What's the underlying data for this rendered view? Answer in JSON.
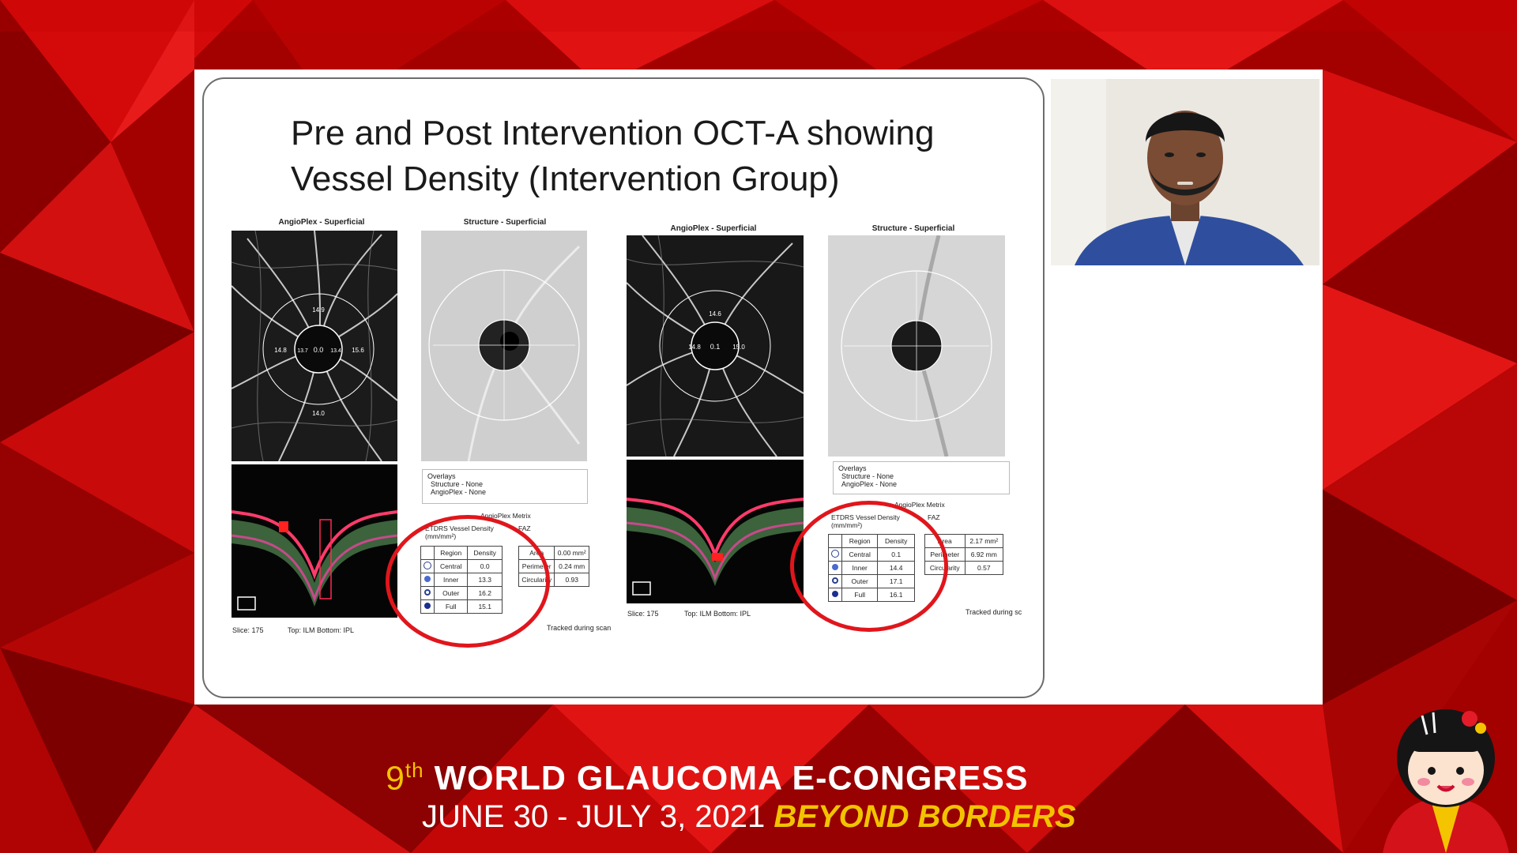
{
  "slide": {
    "title_line1": "Pre and Post Intervention OCT-A  showing",
    "title_line2": "Vessel Density  (Intervention Group)",
    "pre": {
      "angioplex_caption": "AngioPlex - Superficial",
      "structure_caption": "Structure - Superficial",
      "angio_values": {
        "top": "14.9",
        "left": "14.8",
        "center": "0.0",
        "right_inner": "13.4",
        "right": "15.6",
        "inner_left": "13.7",
        "bottom": "14.0"
      },
      "overlays_title": "Overlays",
      "overlay_structure": "Structure - None",
      "overlay_angioplex": "AngioPlex - None",
      "metrix_title": "AngioPlex Metrix",
      "etdrs_title": "ETDRS Vessel Density",
      "etdrs_unit": "(mm/mm²)",
      "faz_title": "FAZ",
      "table_headers": [
        "Region",
        "Density"
      ],
      "rows": [
        {
          "region": "Central",
          "density": "0.0"
        },
        {
          "region": "Inner",
          "density": "13.3"
        },
        {
          "region": "Outer",
          "density": "16.2"
        },
        {
          "region": "Full",
          "density": "15.1"
        }
      ],
      "faz_rows": [
        {
          "label": "Area",
          "value": "0.00 mm²"
        },
        {
          "label": "Perimeter",
          "value": "0.24 mm"
        },
        {
          "label": "Circularity",
          "value": "0.93"
        }
      ],
      "slice": "Slice: 175",
      "top_bottom": "Top: ILM  Bottom: IPL",
      "tracked": "Tracked during scan"
    },
    "post": {
      "angioplex_caption": "AngioPlex - Superficial",
      "structure_caption": "Structure - Superficial",
      "angio_values": {
        "top": "14.6",
        "left": "14.8",
        "center": "0.1",
        "right": "15.0"
      },
      "overlays_title": "Overlays",
      "overlay_structure": "Structure - None",
      "overlay_angioplex": "AngioPlex - None",
      "metrix_title": "AngioPlex Metrix",
      "etdrs_title": "ETDRS Vessel Density",
      "etdrs_unit": "(mm/mm²)",
      "faz_title": "FAZ",
      "table_headers": [
        "Region",
        "Density"
      ],
      "rows": [
        {
          "region": "Central",
          "density": "0.1"
        },
        {
          "region": "Inner",
          "density": "14.4"
        },
        {
          "region": "Outer",
          "density": "17.1"
        },
        {
          "region": "Full",
          "density": "16.1"
        }
      ],
      "faz_rows": [
        {
          "label": "Area",
          "value": "2.17 mm²"
        },
        {
          "label": "Perimeter",
          "value": "6.92 mm"
        },
        {
          "label": "Circularity",
          "value": "0.57"
        }
      ],
      "slice": "Slice: 175",
      "top_bottom": "Top: ILM  Bottom: IPL",
      "tracked": "Tracked during sc"
    }
  },
  "footer": {
    "ordinal": "9",
    "ordinal_suffix": "th",
    "event_name": "WORLD GLAUCOMA E-CONGRESS",
    "dates": "JUNE 30 - JULY 3, 2021",
    "tagline": "BEYOND BORDERS"
  },
  "colors": {
    "background_red": "#c40000",
    "highlight_circle": "#e0161c",
    "footer_accent": "#f2c300"
  }
}
